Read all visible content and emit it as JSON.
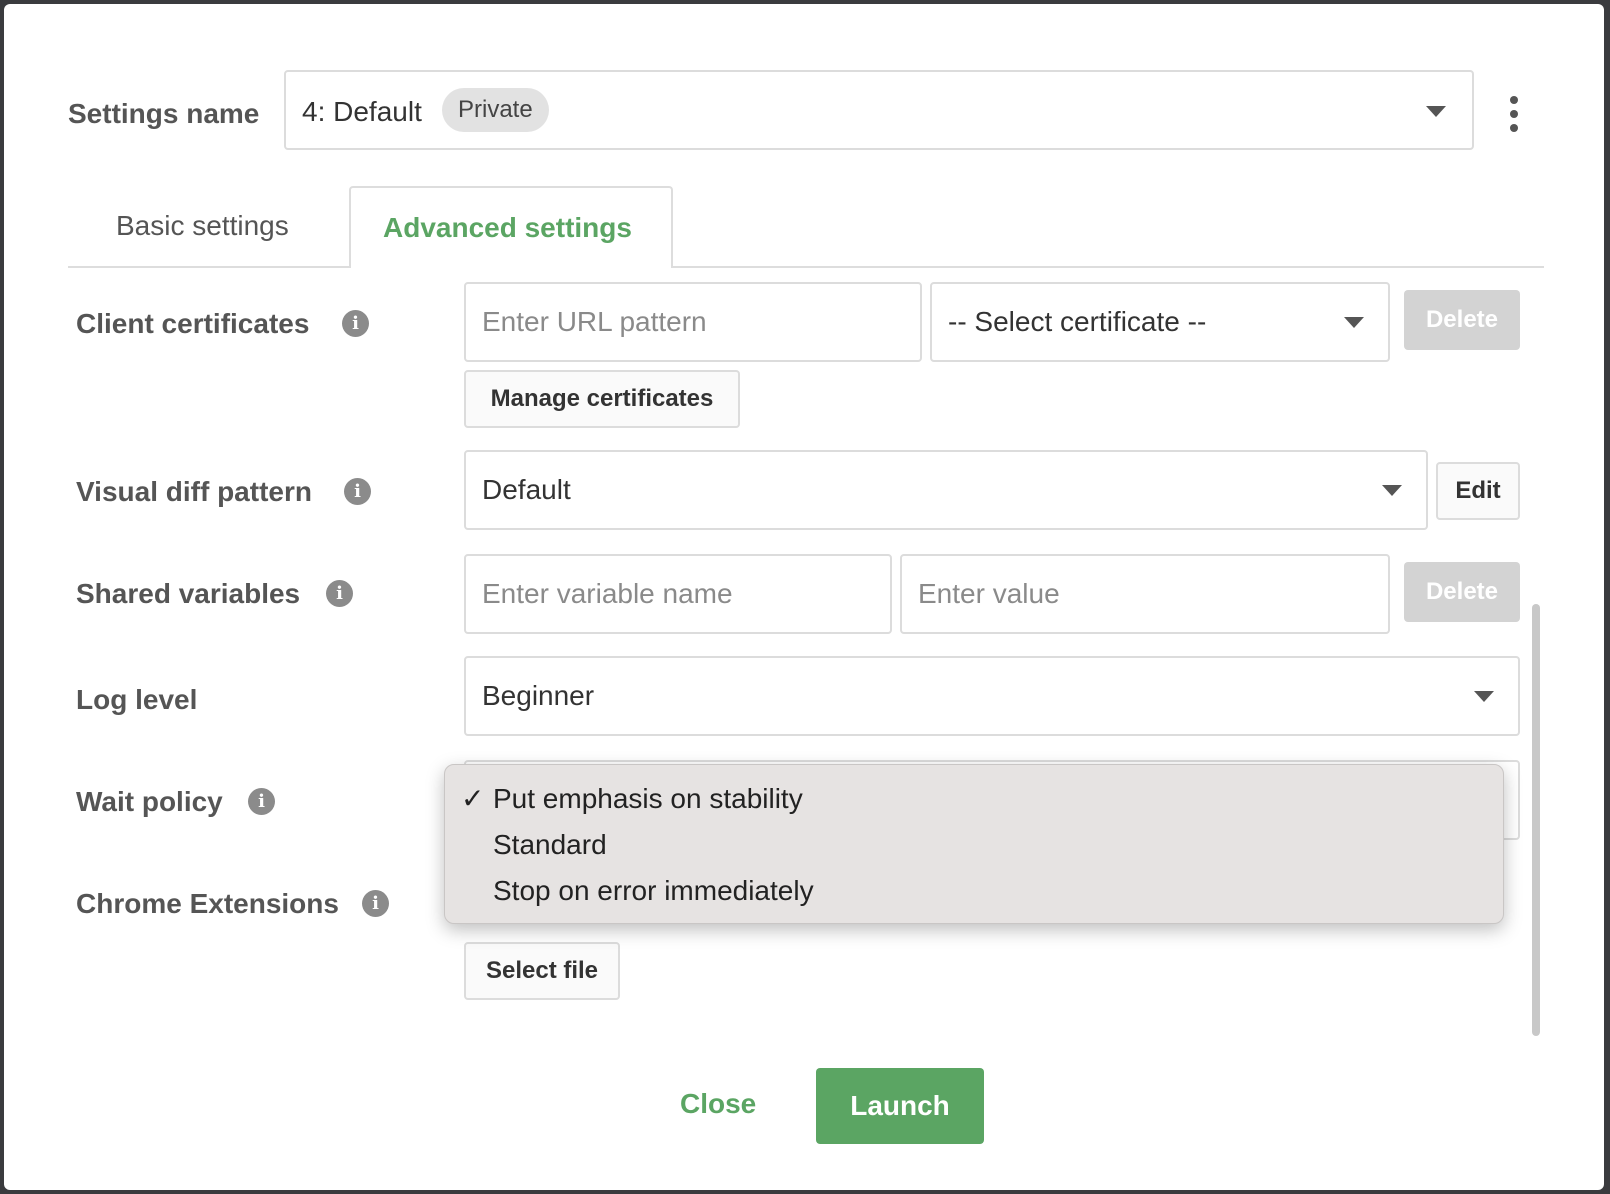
{
  "settings": {
    "label": "Settings name",
    "selected": "4: Default",
    "badge": "Private"
  },
  "tabs": [
    {
      "label": "Basic settings",
      "active": false
    },
    {
      "label": "Advanced settings",
      "active": true
    }
  ],
  "client_certificates": {
    "label": "Client certificates",
    "url_placeholder": "Enter URL pattern",
    "certificate_select": "-- Select certificate --",
    "delete_label": "Delete",
    "manage_label": "Manage certificates"
  },
  "visual_diff": {
    "label": "Visual diff pattern",
    "selected": "Default",
    "edit_label": "Edit"
  },
  "shared_variables": {
    "label": "Shared variables",
    "name_placeholder": "Enter variable name",
    "value_placeholder": "Enter value",
    "delete_label": "Delete"
  },
  "log_level": {
    "label": "Log level",
    "selected": "Beginner"
  },
  "wait_policy": {
    "label": "Wait policy",
    "options": [
      {
        "label": "Put emphasis on stability",
        "checked": true
      },
      {
        "label": "Standard",
        "checked": false
      },
      {
        "label": "Stop on error immediately",
        "checked": false
      }
    ],
    "check_mark": "✓"
  },
  "chrome_extensions": {
    "label": "Chrome Extensions",
    "select_file_label": "Select file"
  },
  "footer": {
    "close_label": "Close",
    "launch_label": "Launch"
  },
  "info_glyph": "i",
  "colors": {
    "accent": "#5ba563",
    "disabled": "#d3d3d3",
    "menu_bg": "#e6e3e2"
  }
}
